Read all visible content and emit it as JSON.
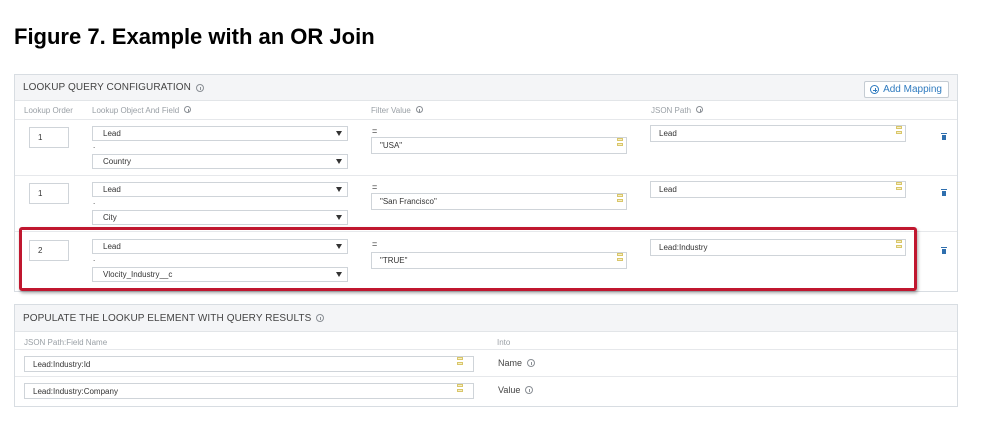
{
  "figure_title": "Figure 7. Example with an OR Join",
  "lookup_panel": {
    "title": "LOOKUP QUERY CONFIGURATION",
    "add_button": "Add Mapping",
    "columns": {
      "order": "Lookup Order",
      "object": "Lookup Object And Field",
      "filter": "Filter Value",
      "json": "JSON Path"
    },
    "rows": [
      {
        "order": "1",
        "object": "Lead",
        "separator": ".",
        "field": "Country",
        "operator": "=",
        "filter": "\"USA\"",
        "json_path": "Lead"
      },
      {
        "order": "1",
        "object": "Lead",
        "separator": ".",
        "field": "City",
        "operator": "=",
        "filter": "\"San Francisco\"",
        "json_path": "Lead"
      },
      {
        "order": "2",
        "object": "Lead",
        "separator": ".",
        "field": "Vlocity_Industry__c",
        "operator": "=",
        "filter": "\"TRUE\"",
        "json_path": "Lead:Industry"
      }
    ]
  },
  "populate_panel": {
    "title": "POPULATE THE LOOKUP ELEMENT WITH QUERY RESULTS",
    "columns": {
      "json": "JSON Path:Field Name",
      "into": "Into"
    },
    "rows": [
      {
        "json_path": "Lead:Industry:Id",
        "into": "Name"
      },
      {
        "json_path": "Lead:Industry:Company",
        "into": "Value"
      }
    ]
  },
  "colors": {
    "highlight": "#c0172f",
    "accent": "#2f7bbf"
  }
}
